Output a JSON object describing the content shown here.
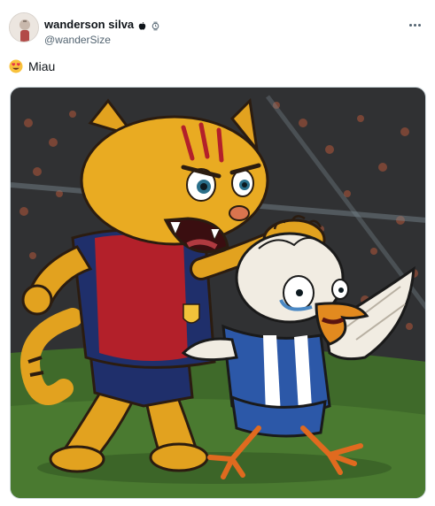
{
  "author": {
    "display_name": "wanderson silva",
    "handle": "@wanderSize"
  },
  "post": {
    "text": "Miau"
  },
  "icons": {
    "verified_badge": "apple-icon",
    "extra_badge": "watch-icon",
    "emoji": "heart-eyes-emoji-icon",
    "more": "more-horizontal-icon"
  },
  "colors": {
    "text_primary": "#0f1419",
    "text_secondary": "#536471",
    "border": "#cfd9de"
  }
}
